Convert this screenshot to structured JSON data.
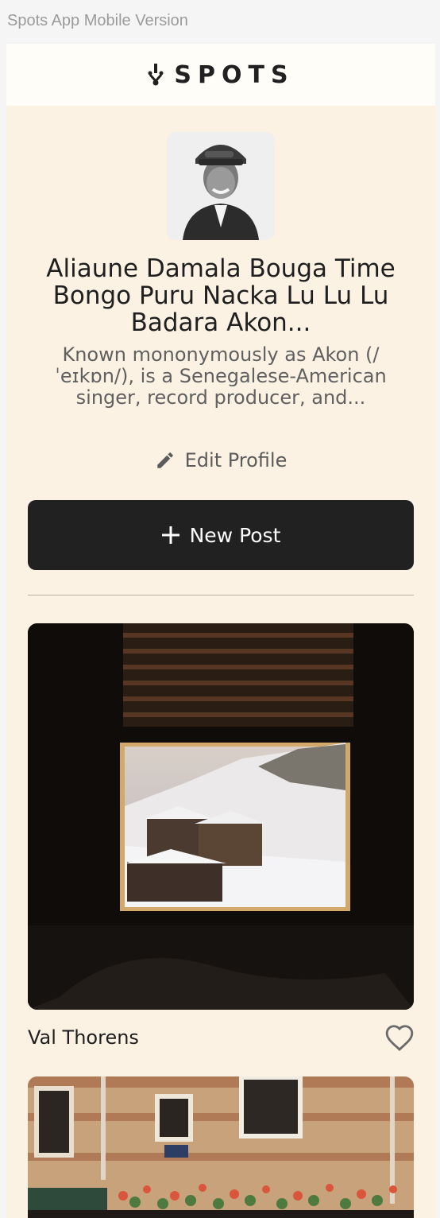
{
  "frame": {
    "label": "Spots App Mobile Version"
  },
  "header": {
    "logo_text": "SPOTS"
  },
  "profile": {
    "name": "Aliaune Damala Bouga Time Bongo Puru Nacka Lu Lu Lu Badara Akon...",
    "bio": "Known mononymously as Akon (/ˈeɪkɒn/), is a Senegalese-American singer, record producer, and...",
    "edit_label": "Edit Profile"
  },
  "actions": {
    "new_post_label": "New Post"
  },
  "cards": [
    {
      "title": "Val Thorens",
      "liked": false
    },
    {
      "title": "",
      "liked": false
    }
  ],
  "colors": {
    "background": "#fbf2e4",
    "header": "#fffdf8",
    "primary_button": "#212121",
    "text": "#1f1f1f",
    "muted_text": "#606060"
  },
  "icons": {
    "logo": "spots-logo-icon",
    "edit": "pencil-icon",
    "new_post": "plus-icon",
    "like": "heart-outline-icon"
  }
}
